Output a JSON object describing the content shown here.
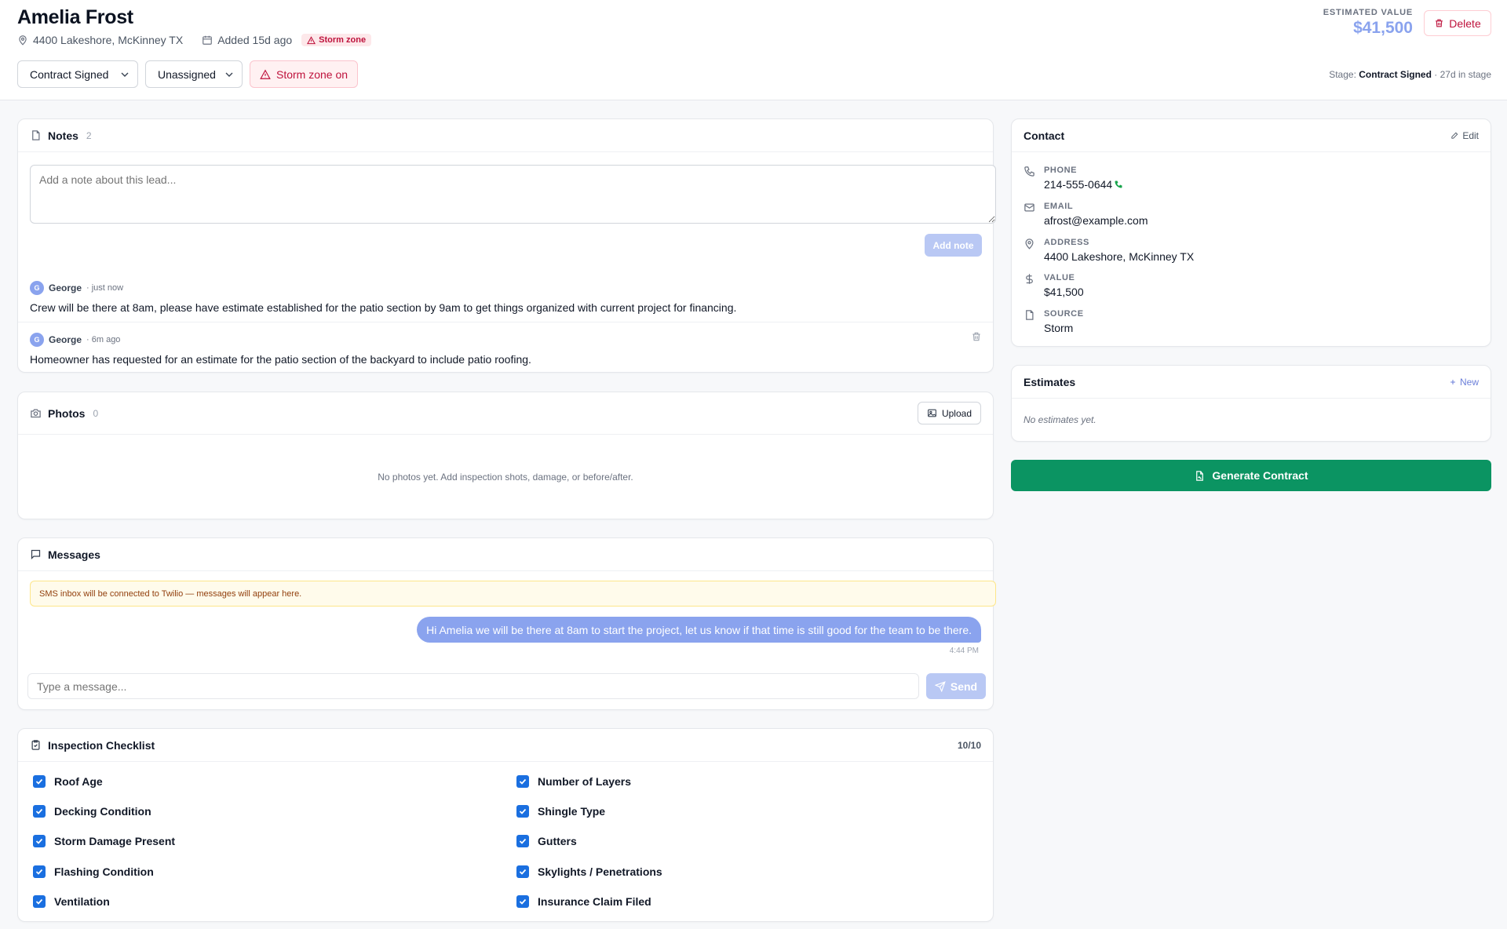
{
  "lead": {
    "name": "Amelia Frost",
    "address": "4400 Lakeshore, McKinney TX",
    "added": "Added 15d ago",
    "storm_badge": "Storm zone"
  },
  "controls": {
    "stage_value": "Contract Signed",
    "assignee_value": "Unassigned",
    "storm_toggle_label": "Storm zone on"
  },
  "estimated": {
    "label": "ESTIMATED VALUE",
    "value": "$41,500"
  },
  "header": {
    "delete_label": "Delete",
    "stage_prefix": "Stage:",
    "stage_name": "Contract Signed",
    "stage_suffix": "· 27d in stage"
  },
  "notes": {
    "title": "Notes",
    "count": "2",
    "placeholder": "Add a note about this lead...",
    "add_label": "Add note",
    "items": [
      {
        "avatar": "G",
        "author": "George",
        "time": "· just now",
        "text": "Crew will be there at 8am, please have estimate established for the patio section by 9am to get things organized with current project for financing."
      },
      {
        "avatar": "G",
        "author": "George",
        "time": "· 6m ago",
        "text": "Homeowner has requested for an estimate for the patio section of the backyard to include patio roofing."
      }
    ]
  },
  "photos": {
    "title": "Photos",
    "count": "0",
    "upload_label": "Upload",
    "empty": "No photos yet. Add inspection shots, damage, or before/after."
  },
  "messages": {
    "title": "Messages",
    "banner": "SMS inbox will be connected to Twilio — messages will appear here.",
    "bubble": "Hi Amelia we will be there at 8am to start the project, let us know if that time is still good for the team to be there.",
    "bubble_time": "4:44 PM",
    "placeholder": "Type a message...",
    "send_label": "Send"
  },
  "checklist": {
    "title": "Inspection Checklist",
    "count": "10/10",
    "left": [
      "Roof Age",
      "Decking Condition",
      "Storm Damage Present",
      "Flashing Condition",
      "Ventilation"
    ],
    "right": [
      "Number of Layers",
      "Shingle Type",
      "Gutters",
      "Skylights / Penetrations",
      "Insurance Claim Filed"
    ]
  },
  "contact": {
    "title": "Contact",
    "edit_label": "Edit",
    "phone_label": "PHONE",
    "phone": "214-555-0644",
    "email_label": "EMAIL",
    "email": "afrost@example.com",
    "address_label": "ADDRESS",
    "address": "4400 Lakeshore, McKinney TX",
    "value_label": "VALUE",
    "value": "$41,500",
    "source_label": "SOURCE",
    "source": "Storm"
  },
  "estimates": {
    "title": "Estimates",
    "new_label": "New",
    "empty": "No estimates yet."
  },
  "actions": {
    "generate_label": "Generate Contract"
  },
  "colors": {
    "accent": "#8aa3ee",
    "danger": "#be123c",
    "success": "#0b9462",
    "checkbox": "#1a6fe0"
  }
}
